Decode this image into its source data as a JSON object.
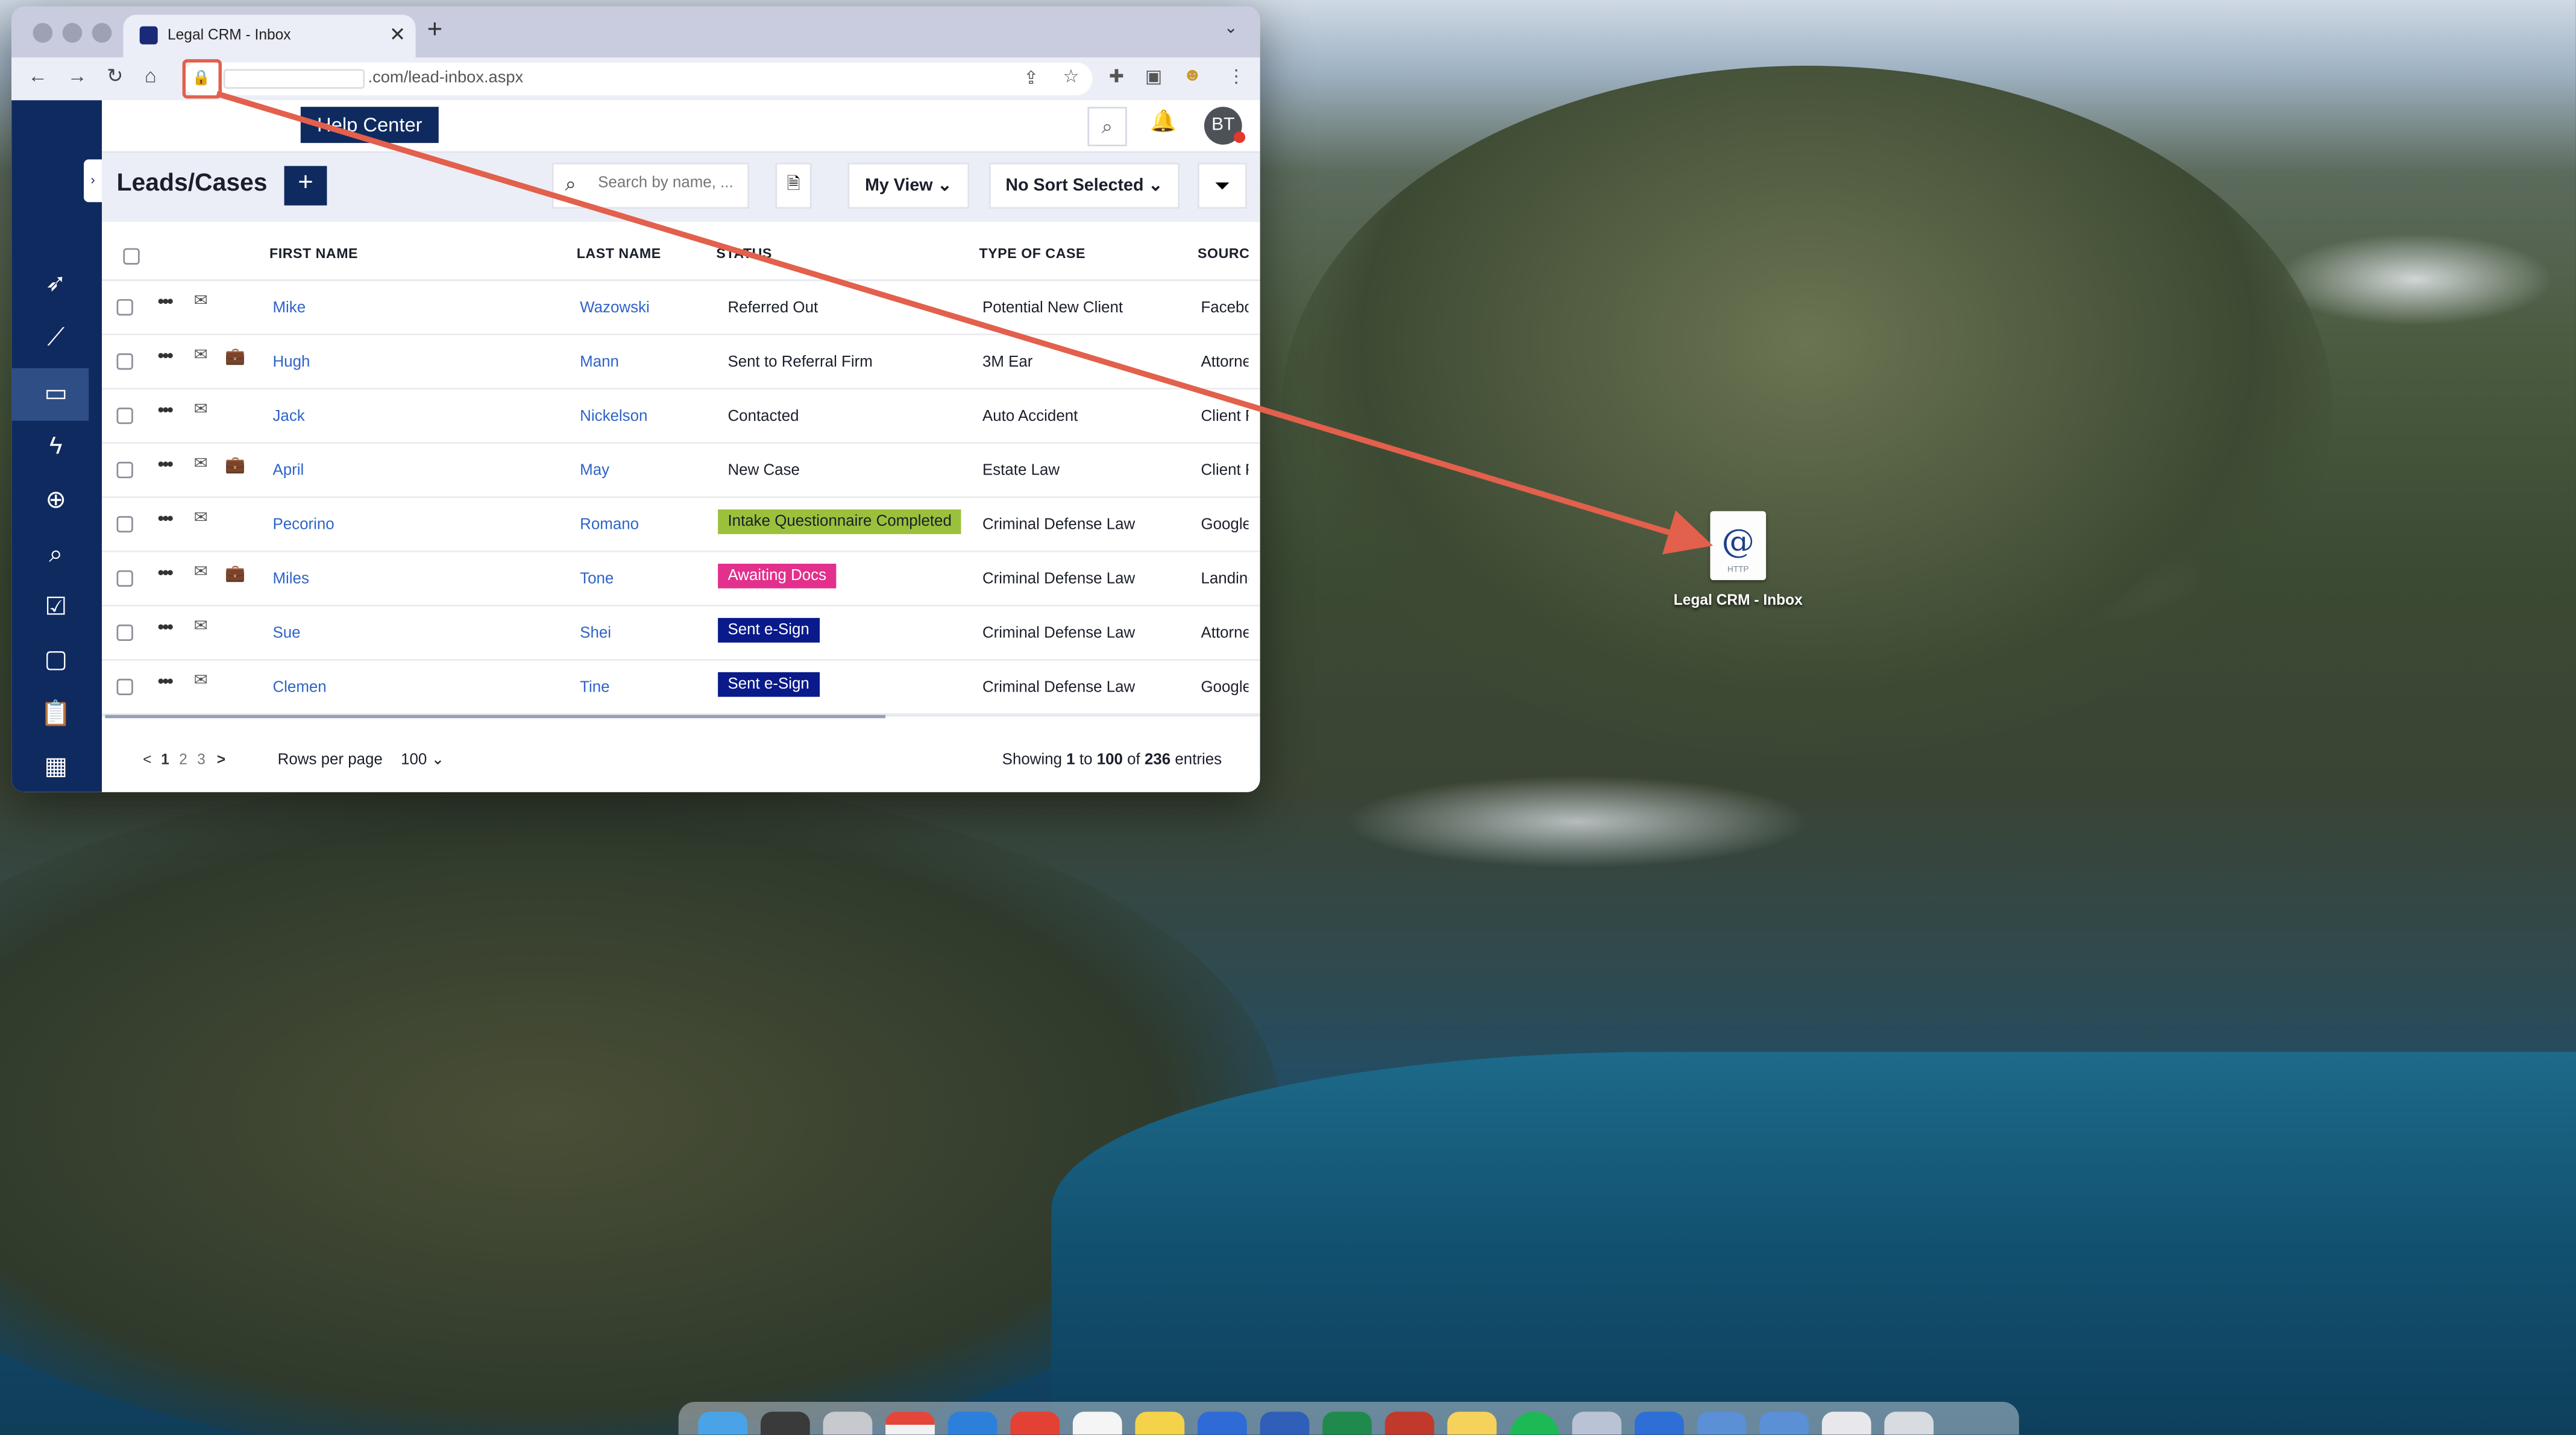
{
  "browser": {
    "tab_title": "Legal CRM - Inbox",
    "url_visible": ".com/lead-inbox.aspx",
    "new_tab": "+",
    "close_tab": "✕"
  },
  "app": {
    "help_center": "Help Center",
    "avatar_initials": "BT",
    "page_title": "Leads/Cases",
    "add_label": "+",
    "search_placeholder": "Search by name, ...",
    "view_select": "My View",
    "sort_select": "No Sort Selected",
    "columns": [
      "FIRST NAME",
      "LAST NAME",
      "STATUS",
      "TYPE OF CASE",
      "SOURC"
    ],
    "rows": [
      {
        "first": "Mike",
        "last": "Wazowski",
        "status": "Referred Out",
        "type": "Potential New Client",
        "source": "Facebook",
        "brief": false
      },
      {
        "first": "Hugh",
        "last": "Mann",
        "status": "Sent to Referral Firm",
        "type": "3M Ear",
        "source": "Attorney",
        "brief": true
      },
      {
        "first": "Jack",
        "last": "Nickelson",
        "status": "Contacted",
        "type": "Auto Accident",
        "source": "Client Referral",
        "brief": false
      },
      {
        "first": "April",
        "last": "May",
        "status": "New Case",
        "type": "Estate Law",
        "source": "Client Referral",
        "brief": true
      },
      {
        "first": "Pecorino",
        "last": "Romano",
        "status": "Intake Questionnaire Completed",
        "type": "Criminal Defense Law",
        "source": "Google",
        "brief": false,
        "badge_bg": "#9bc13c",
        "badge_fg": "#1b1f2b"
      },
      {
        "first": "Miles",
        "last": "Tone",
        "status": "Awaiting Docs",
        "type": "Criminal Defense Law",
        "source": "Landing",
        "brief": true,
        "badge_bg": "#e2308c",
        "badge_fg": "#ffffff"
      },
      {
        "first": "Sue",
        "last": "Shei",
        "status": "Sent e-Sign",
        "type": "Criminal Defense Law",
        "source": "Attorney",
        "brief": false,
        "badge_bg": "#0a1a8a",
        "badge_fg": "#ffffff"
      },
      {
        "first": "Clemen",
        "last": "Tine",
        "status": "Sent e-Sign",
        "type": "Criminal Defense Law",
        "source": "Google",
        "brief": false,
        "badge_bg": "#0a1a8a",
        "badge_fg": "#ffffff"
      }
    ],
    "pagination": {
      "prev": "<",
      "pages": [
        "1",
        "2",
        "3"
      ],
      "next": ">"
    },
    "rows_per_page_label": "Rows per page",
    "rows_per_page_value": "100",
    "showing": {
      "prefix": "Showing",
      "from": "1",
      "to_word": "to",
      "to": "100",
      "of_word": "of",
      "total": "236",
      "suffix": "entries"
    }
  },
  "desktop": {
    "file_icon_glyph": "@",
    "file_icon_ext": "HTTP",
    "file_label": "Legal CRM - Inbox"
  },
  "colors": {
    "nav_dark": "#0f2a5f",
    "link": "#2e63c8",
    "annotation_arrow": "#e2604c"
  },
  "icons": [
    "rocket-icon",
    "chart-icon",
    "inbox-icon",
    "lightning-icon",
    "plus-circle-icon",
    "search-icon",
    "checklist-icon",
    "chat-icon",
    "clipboard-icon",
    "calendar-icon"
  ]
}
